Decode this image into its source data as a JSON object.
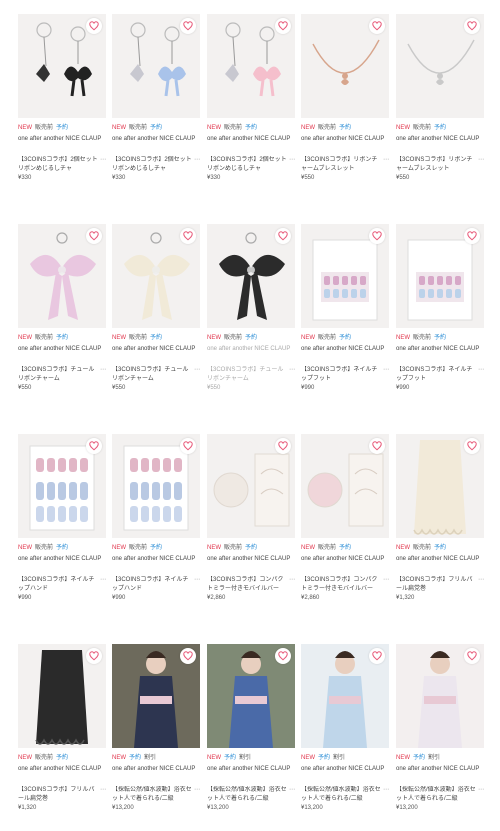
{
  "products": [
    {
      "new": "NEW",
      "sale": "販売前",
      "pre": "予約",
      "brand": "one after another NICE CLAUP",
      "name": "【3COINSコラボ】2個セットリボンめじるしチャ",
      "price": "¥330",
      "img": "charm-black",
      "fav": "heart-icon"
    },
    {
      "new": "NEW",
      "sale": "販売前",
      "pre": "予約",
      "brand": "one after another NICE CLAUP",
      "name": "【3COINSコラボ】2個セットリボンめじるしチャ",
      "price": "¥330",
      "img": "charm-blue",
      "fav": "heart-icon"
    },
    {
      "new": "NEW",
      "sale": "販売前",
      "pre": "予約",
      "brand": "one after another NICE CLAUP",
      "name": "【3COINSコラボ】2個セットリボンめじるしチャ",
      "price": "¥330",
      "img": "charm-pink",
      "fav": "heart-icon"
    },
    {
      "new": "NEW",
      "sale": "販売前",
      "pre": "予約",
      "brand": "one after another NICE CLAUP",
      "name": "【3COINSコラボ】リボンチャームブレスレット",
      "price": "¥550",
      "img": "bracelet-gold",
      "fav": "heart-icon"
    },
    {
      "new": "NEW",
      "sale": "販売前",
      "pre": "予約",
      "brand": "one after another NICE CLAUP",
      "name": "【3COINSコラボ】リボンチャームブレスレット",
      "price": "¥550",
      "img": "bracelet-silver",
      "fav": "heart-icon"
    },
    {
      "new": "NEW",
      "sale": "販売前",
      "pre": "予約",
      "brand": "one after another NICE CLAUP",
      "name": "【3COINSコラボ】チュールリボンチャーム",
      "price": "¥550",
      "img": "bow-pink",
      "fav": "heart-icon"
    },
    {
      "new": "NEW",
      "sale": "販売前",
      "pre": "予約",
      "brand": "one after another NICE CLAUP",
      "name": "【3COINSコラボ】チュールリボンチャーム",
      "price": "¥550",
      "img": "bow-cream",
      "fav": "heart-icon"
    },
    {
      "new": "NEW",
      "sale": "販売前",
      "pre": "予約",
      "brand": "one after another NICE CLAUP",
      "name": "【3COINSコラボ】チュールリボンチャーム",
      "price": "¥550",
      "img": "bow-black",
      "fav": "heart-icon",
      "muted": true
    },
    {
      "new": "NEW",
      "sale": "販売前",
      "pre": "予約",
      "brand": "one after another NICE CLAUP",
      "name": "【3COINSコラボ】ネイルチップフット",
      "price": "¥990",
      "img": "nails-box",
      "fav": "heart-icon"
    },
    {
      "new": "NEW",
      "sale": "販売前",
      "pre": "予約",
      "brand": "one after another NICE CLAUP",
      "name": "【3COINSコラボ】ネイルチップフット",
      "price": "¥990",
      "img": "nails-box2",
      "fav": "heart-icon"
    },
    {
      "new": "NEW",
      "sale": "販売前",
      "pre": "予約",
      "brand": "one after another NICE CLAUP",
      "name": "【3COINSコラボ】ネイルチップハンド",
      "price": "¥990",
      "img": "nails-hand",
      "fav": "heart-icon"
    },
    {
      "new": "NEW",
      "sale": "販売前",
      "pre": "予約",
      "brand": "one after another NICE CLAUP",
      "name": "【3COINSコラボ】ネイルチップハンド",
      "price": "¥990",
      "img": "nails-hand2",
      "fav": "heart-icon"
    },
    {
      "new": "NEW",
      "sale": "販売前",
      "pre": "予約",
      "brand": "one after another NICE CLAUP",
      "name": "【3COINSコラボ】コンパクトミラー付きモバイルバー",
      "price": "¥2,860",
      "img": "mirror-white",
      "fav": "heart-icon"
    },
    {
      "new": "NEW",
      "sale": "販売前",
      "pre": "予約",
      "brand": "one after another NICE CLAUP",
      "name": "【3COINSコラボ】コンパクトミラー付きモバイルバー",
      "price": "¥2,860",
      "img": "mirror-pink",
      "fav": "heart-icon"
    },
    {
      "new": "NEW",
      "sale": "販売前",
      "pre": "予約",
      "brand": "one after another NICE CLAUP",
      "name": "【3COINSコラボ】フリルパール扁党巻",
      "price": "¥1,320",
      "img": "lace-cream",
      "fav": "heart-icon"
    },
    {
      "new": "NEW",
      "sale": "販売前",
      "pre": "予約",
      "brand": "one after another NICE CLAUP",
      "name": "【3COINSコラボ】フリルパール扁党巻",
      "price": "¥1,320",
      "img": "lace-black",
      "fav": "heart-icon"
    },
    {
      "new": "NEW",
      "sale": "",
      "pre": "予約",
      "dis": "割引",
      "brand": "one after another NICE CLAUP",
      "name": "【採転公然/値水波動】浴衣セット人で着られる/二級",
      "price": "¥13,200",
      "img": "yukata-navy",
      "fav": "heart-icon"
    },
    {
      "new": "NEW",
      "sale": "",
      "pre": "予約",
      "dis": "割引",
      "brand": "one after another NICE CLAUP",
      "name": "【採転公然/値水波動】浴衣セット人で着られる/二級",
      "price": "¥13,200",
      "img": "yukata-blue",
      "fav": "heart-icon"
    },
    {
      "new": "NEW",
      "sale": "",
      "pre": "予約",
      "dis": "割引",
      "brand": "one after another NICE CLAUP",
      "name": "【採転公然/値水波動】浴衣セット人で着られる/二級",
      "price": "¥13,200",
      "img": "yukata-light",
      "fav": "heart-icon"
    },
    {
      "new": "NEW",
      "sale": "",
      "pre": "予約",
      "dis": "割引",
      "brand": "one after another NICE CLAUP",
      "name": "【採転公然/値水波動】浴衣セット人で着られる/二級",
      "price": "¥13,200",
      "img": "yukata-white",
      "fav": "heart-icon"
    }
  ],
  "more_label": "⋯",
  "colors": {
    "new": "#e0344b",
    "preorder": "#2e8fd6",
    "heart": "#e85a7a",
    "thumb_bg": "#f3f1f0"
  }
}
